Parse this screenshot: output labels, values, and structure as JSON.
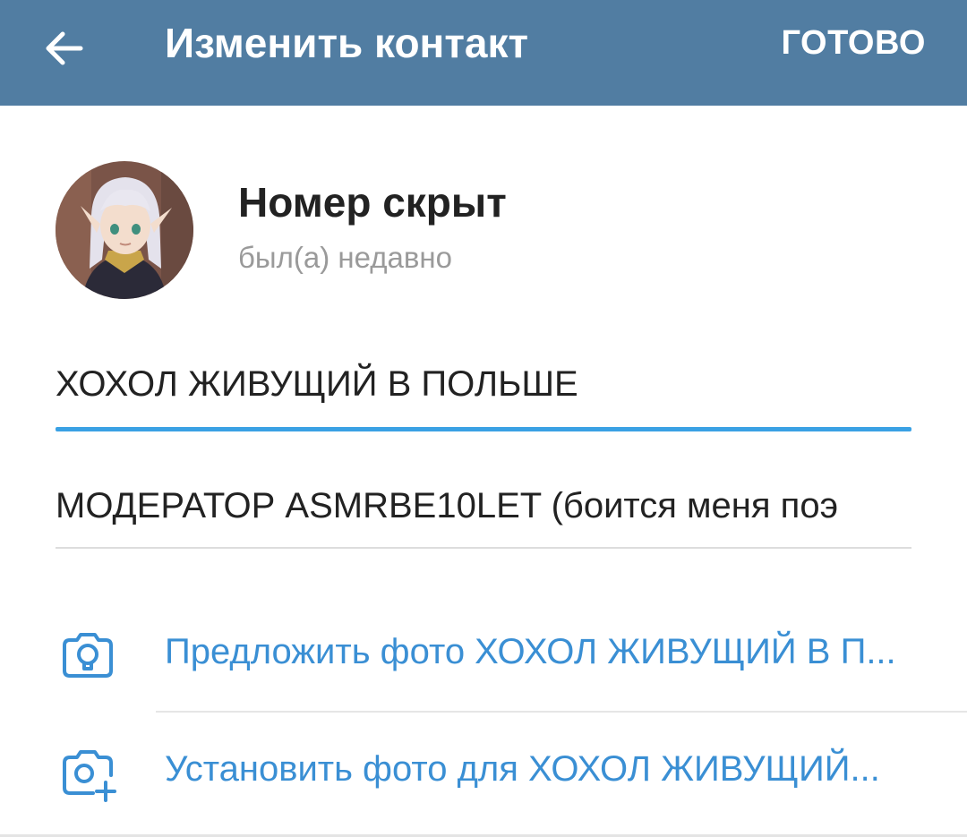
{
  "colors": {
    "appbar": "#517da2",
    "accent": "#3aa1e4",
    "link": "#3a8fd4",
    "text": "#222222",
    "muted": "#9a9a9a"
  },
  "header": {
    "back_icon": "arrow-left-icon",
    "title": "Изменить контакт",
    "done_label": "ГОТОВО"
  },
  "profile": {
    "avatar": "anime-character-avatar",
    "name": "Номер скрыт",
    "status": "был(а) недавно"
  },
  "form": {
    "first_name": "ХОХОЛ ЖИВУЩИЙ В ПОЛЬШЕ",
    "last_name": "МОДЕРАТОР ASMRBE10LET (боится меня поэ"
  },
  "actions": [
    {
      "icon": "camera-suggest-icon",
      "label": "Предложить фото ХОХОЛ ЖИВУЩИЙ В П..."
    },
    {
      "icon": "camera-add-icon",
      "label": "Установить фото для ХОХОЛ ЖИВУЩИЙ..."
    }
  ]
}
